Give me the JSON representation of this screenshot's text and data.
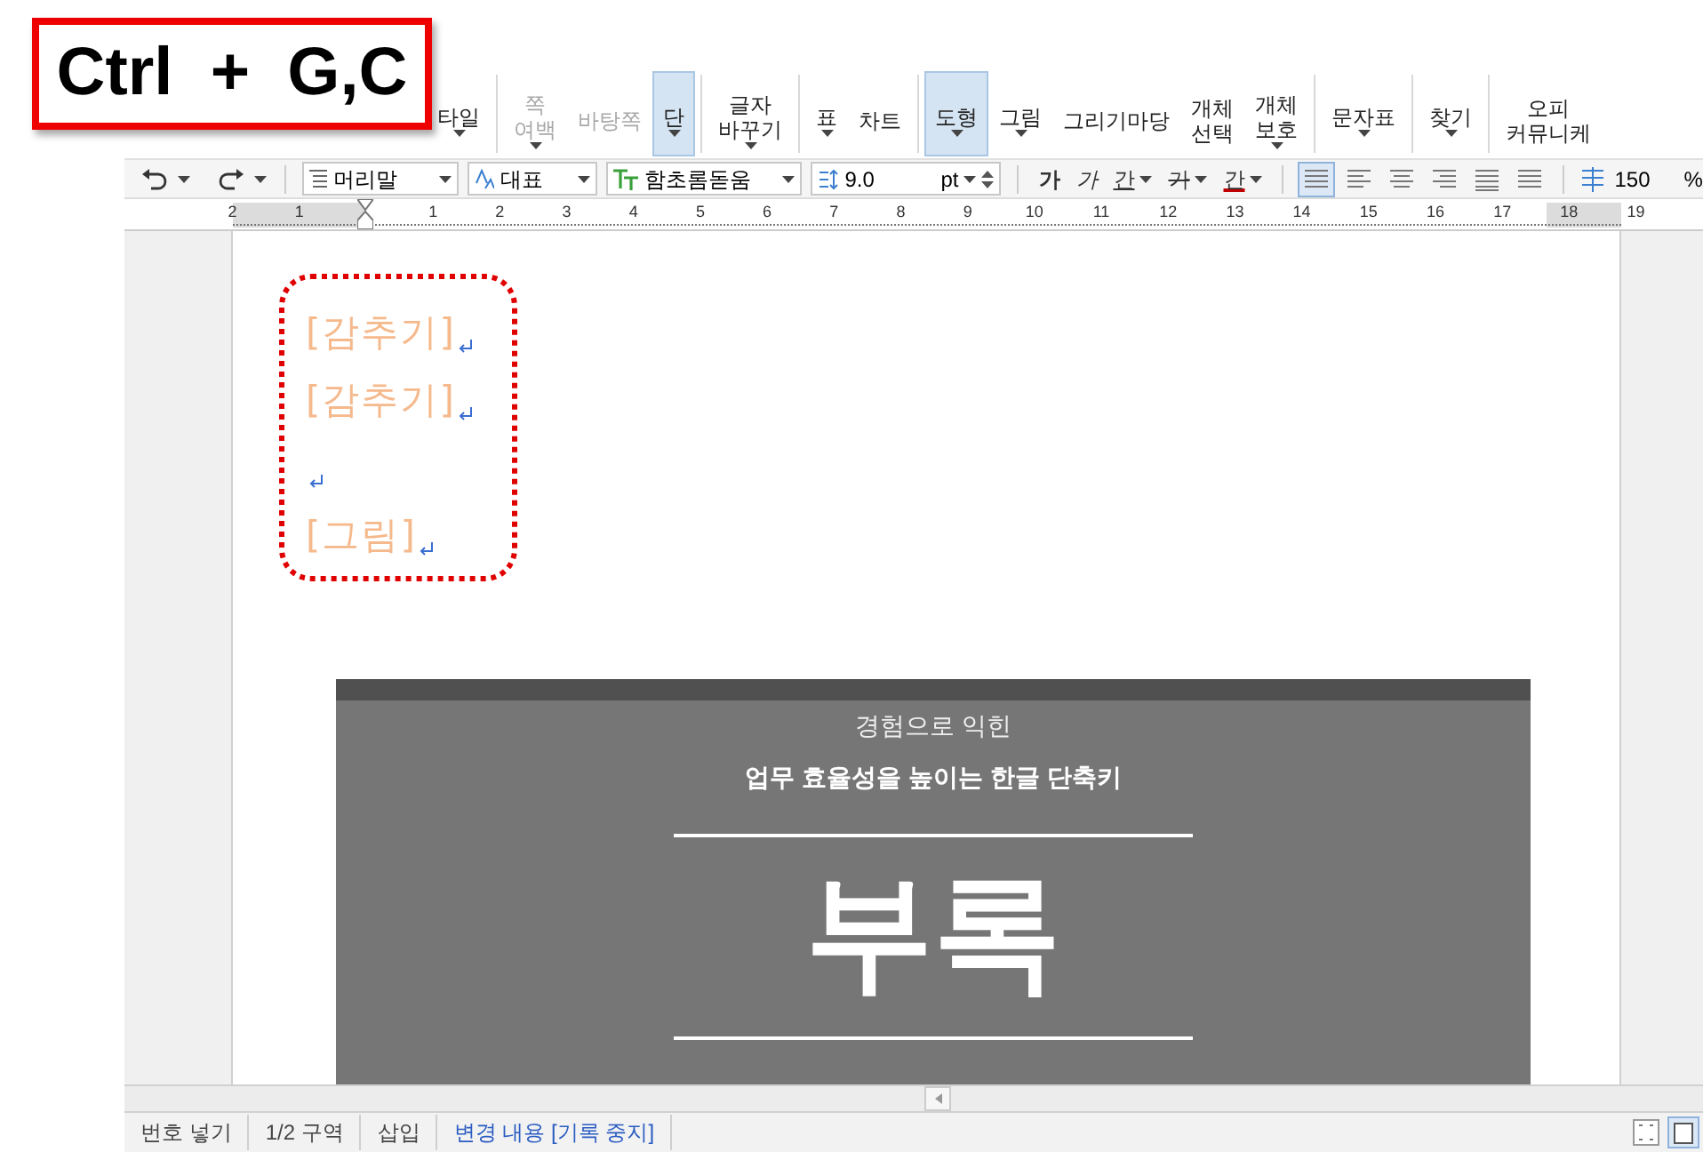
{
  "shortcut_overlay": {
    "text": "Ctrl  +  G,C"
  },
  "ribbon": [
    {
      "lines": [
        "타일"
      ],
      "dropdown": true,
      "selected": false,
      "separator_after": true
    },
    {
      "lines": [
        "쪽",
        "여백"
      ],
      "dropdown": true,
      "selected": false,
      "disabled": true,
      "separator_after": false
    },
    {
      "lines": [
        "바탕쪽"
      ],
      "dropdown": false,
      "selected": false,
      "disabled": true,
      "separator_after": false
    },
    {
      "lines": [
        "단"
      ],
      "dropdown": true,
      "selected": true,
      "disabled": false,
      "separator_after": true
    },
    {
      "lines": [
        "글자",
        "바꾸기"
      ],
      "dropdown": true,
      "selected": false,
      "disabled": false,
      "separator_after": true
    },
    {
      "lines": [
        "표"
      ],
      "dropdown": true,
      "selected": false,
      "disabled": false,
      "separator_after": false
    },
    {
      "lines": [
        "차트"
      ],
      "dropdown": false,
      "selected": false,
      "disabled": false,
      "separator_after": true
    },
    {
      "lines": [
        "도형"
      ],
      "dropdown": true,
      "selected": true,
      "disabled": false,
      "separator_after": false
    },
    {
      "lines": [
        "그림"
      ],
      "dropdown": true,
      "selected": false,
      "disabled": false,
      "separator_after": false
    },
    {
      "lines": [
        "그리기마당"
      ],
      "dropdown": false,
      "selected": false,
      "disabled": false,
      "separator_after": false
    },
    {
      "lines": [
        "개체",
        "선택"
      ],
      "dropdown": false,
      "selected": false,
      "disabled": false,
      "separator_after": false
    },
    {
      "lines": [
        "개체",
        "보호"
      ],
      "dropdown": true,
      "selected": false,
      "disabled": false,
      "separator_after": true
    },
    {
      "lines": [
        "문자표"
      ],
      "dropdown": true,
      "selected": false,
      "disabled": false,
      "separator_after": true
    },
    {
      "lines": [
        "찾기"
      ],
      "dropdown": true,
      "selected": false,
      "disabled": false,
      "separator_after": true
    },
    {
      "lines": [
        "오피",
        "커뮤니케"
      ],
      "dropdown": false,
      "selected": false,
      "disabled": false,
      "separator_after": false
    }
  ],
  "toolbar": {
    "style": "머리말",
    "language": "대표",
    "font": "함초롬돋움",
    "size": "9.0",
    "unit": "pt",
    "format_buttons": [
      {
        "text": "가",
        "kind": "bold",
        "dropdown": false
      },
      {
        "text": "가",
        "kind": "italic",
        "dropdown": false
      },
      {
        "text": "간",
        "kind": "underline",
        "dropdown": true
      },
      {
        "text": "가",
        "kind": "strike",
        "dropdown": true
      },
      {
        "text": "간",
        "kind": "color",
        "dropdown": true
      }
    ],
    "alignments": [
      {
        "selected": true
      },
      {
        "selected": false
      },
      {
        "selected": false
      },
      {
        "selected": false
      },
      {
        "selected": false
      },
      {
        "selected": false
      }
    ],
    "line_spacing": "150",
    "line_spacing_unit": "%"
  },
  "ruler": [
    {
      "kind": "number",
      "text": "2"
    },
    {
      "kind": "number",
      "text": "1"
    },
    {
      "kind": "indent"
    },
    {
      "kind": "number",
      "text": "1"
    },
    {
      "kind": "number",
      "text": "2"
    },
    {
      "kind": "number",
      "text": "3"
    },
    {
      "kind": "number",
      "text": "4"
    },
    {
      "kind": "number",
      "text": "5"
    },
    {
      "kind": "number",
      "text": "6"
    },
    {
      "kind": "number",
      "text": "7"
    },
    {
      "kind": "number",
      "text": "8"
    },
    {
      "kind": "number",
      "text": "9"
    },
    {
      "kind": "number",
      "text": "10"
    },
    {
      "kind": "number",
      "text": "11"
    },
    {
      "kind": "number",
      "text": "12"
    },
    {
      "kind": "number",
      "text": "13"
    },
    {
      "kind": "number",
      "text": "14"
    },
    {
      "kind": "number",
      "text": "15"
    },
    {
      "kind": "number",
      "text": "16"
    },
    {
      "kind": "number",
      "text": "17"
    },
    {
      "kind": "number",
      "text": "18"
    },
    {
      "kind": "number",
      "text": "19"
    }
  ],
  "document": {
    "paragraphs": [
      {
        "kind": "text",
        "text": "[감추기]"
      },
      {
        "kind": "text",
        "text": "[감추기]"
      },
      {
        "kind": "empty"
      },
      {
        "kind": "text",
        "text": "[그림]"
      }
    ],
    "cover": {
      "subtitle": "경험으로 익힌",
      "title": "업무 효율성을 높이는 한글 단축키",
      "heading": "부록"
    }
  },
  "status_bar": [
    {
      "text": "번호 넣기",
      "highlight": false
    },
    {
      "text": "1/2 구역",
      "highlight": false
    },
    {
      "text": "삽입",
      "highlight": false
    },
    {
      "text": "변경 내용 [기록 중지]",
      "highlight": true
    }
  ]
}
